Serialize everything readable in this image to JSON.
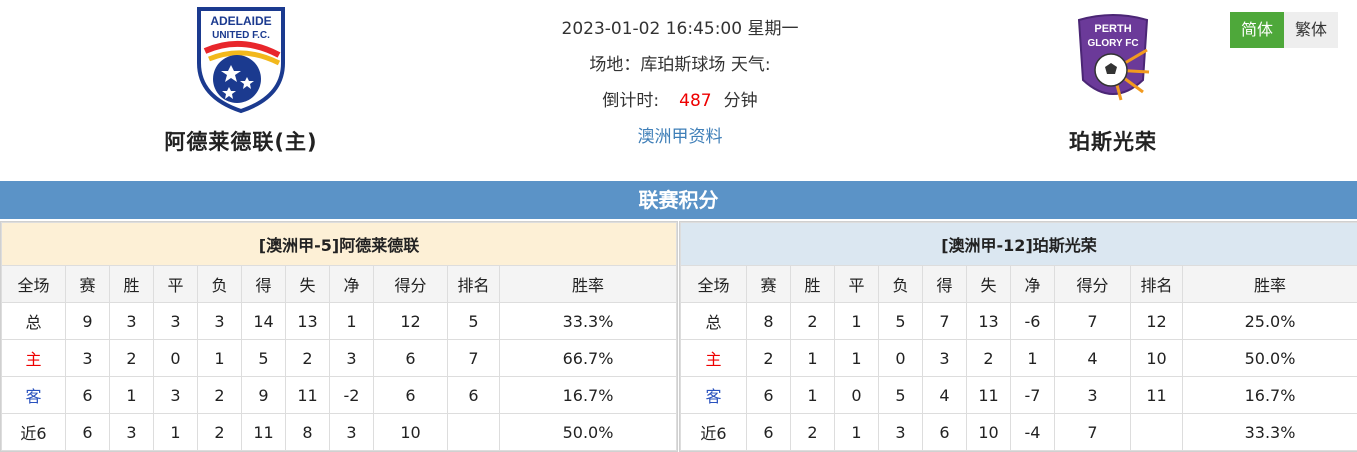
{
  "datetime": "2023-01-02 16:45:00 星期一",
  "venue": "场地：库珀斯球场 天气:",
  "countdown_label": "倒计时:",
  "countdown_value": "487",
  "countdown_unit": "分钟",
  "league_link": "澳洲甲资料",
  "lang": {
    "simplified": "简体",
    "traditional": "繁体"
  },
  "home_team": {
    "name": "阿德莱德联(主)",
    "logo_text_top": "ADELAIDE",
    "logo_text_bottom": "UNITED F.C."
  },
  "away_team": {
    "name": "珀斯光荣",
    "logo_text_top": "PERTH",
    "logo_text_bottom": "GLORY FC"
  },
  "section_title": "联赛积分",
  "columns": [
    "全场",
    "赛",
    "胜",
    "平",
    "负",
    "得",
    "失",
    "净",
    "得分",
    "排名",
    "胜率"
  ],
  "home_table": {
    "title": "[澳洲甲-5]阿德莱德联",
    "rows": [
      [
        "总",
        "9",
        "3",
        "3",
        "3",
        "14",
        "13",
        "1",
        "12",
        "5",
        "33.3%"
      ],
      [
        "主",
        "3",
        "2",
        "0",
        "1",
        "5",
        "2",
        "3",
        "6",
        "7",
        "66.7%"
      ],
      [
        "客",
        "6",
        "1",
        "3",
        "2",
        "9",
        "11",
        "-2",
        "6",
        "6",
        "16.7%"
      ],
      [
        "近6",
        "6",
        "3",
        "1",
        "2",
        "11",
        "8",
        "3",
        "10",
        "",
        "50.0%"
      ]
    ]
  },
  "away_table": {
    "title": "[澳洲甲-12]珀斯光荣",
    "rows": [
      [
        "总",
        "8",
        "2",
        "1",
        "5",
        "7",
        "13",
        "-6",
        "7",
        "12",
        "25.0%"
      ],
      [
        "主",
        "2",
        "1",
        "1",
        "0",
        "3",
        "2",
        "1",
        "4",
        "10",
        "50.0%"
      ],
      [
        "客",
        "6",
        "1",
        "0",
        "5",
        "4",
        "11",
        "-7",
        "3",
        "11",
        "16.7%"
      ],
      [
        "近6",
        "6",
        "2",
        "1",
        "3",
        "6",
        "10",
        "-4",
        "7",
        "",
        "33.3%"
      ]
    ]
  },
  "colors": {
    "band": "#5b93c7",
    "home_label": "#e00000",
    "away_label": "#2a52be",
    "accent_green": "#4ea83a"
  }
}
